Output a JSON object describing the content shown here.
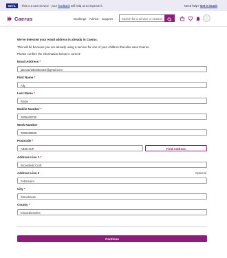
{
  "beta_bar": {
    "tag": "BETA",
    "text_before": "This is a new service - your",
    "feedback_link": "feedback",
    "text_after": "will help us to improve it",
    "help_text": "Need help?",
    "help_link": "Get in touch"
  },
  "header": {
    "brand": "Caerus",
    "nav": [
      "Bookings",
      "Advice",
      "Support"
    ],
    "search_placeholder": "Search for a service or session",
    "icons": [
      "search-icon",
      "basket-icon",
      "heart-icon",
      "bell-icon",
      "avatar"
    ]
  },
  "intro": {
    "headline": "We've detected your email address is already in Caerus.",
    "line1": "This will be because you are already using a service for one of your children that also uses Caerus.",
    "line2": "Please confirm the information below is correct:"
  },
  "form": {
    "email": {
      "label": "Email Address",
      "value": "jakecambbelahode2@gmail.com"
    },
    "first_name": {
      "label": "First Name",
      "value": "Ally"
    },
    "last_name": {
      "label": "Last Name",
      "value": "Rodie"
    },
    "mobile": {
      "label": "Mobile Number",
      "value": "0825406790"
    },
    "work": {
      "label": "Work Number",
      "value": "0825408965"
    },
    "postcode": {
      "label": "Postcode",
      "value": "AB39 3UP"
    },
    "find_address_label": "Find Address",
    "address1": {
      "label": "Address Line 1",
      "value": "Broomfield Croft"
    },
    "address2": {
      "label": "Address Line 2",
      "value": "Fettercairn",
      "optional": "Optional"
    },
    "city": {
      "label": "City",
      "value": "Stonehaven"
    },
    "county": {
      "label": "County",
      "value": "Kincardineshire"
    },
    "required_marker": "*",
    "continue_label": "Continue"
  },
  "colors": {
    "brand_purple": "#8f1b7d",
    "beta_blue": "#1d2d8c",
    "required_red": "#c8102e"
  }
}
